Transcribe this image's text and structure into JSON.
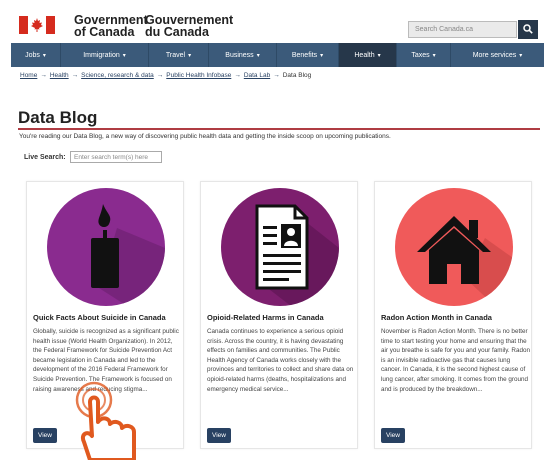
{
  "header": {
    "gov_en_line1": "Government",
    "gov_en_line2": "of Canada",
    "gov_fr_line1": "Gouvernement",
    "gov_fr_line2": "du Canada",
    "search_placeholder": "Search Canada.ca"
  },
  "nav": {
    "items": [
      {
        "label": "Jobs",
        "active": false
      },
      {
        "label": "Immigration",
        "active": false
      },
      {
        "label": "Travel",
        "active": false
      },
      {
        "label": "Business",
        "active": false
      },
      {
        "label": "Benefits",
        "active": false
      },
      {
        "label": "Health",
        "active": true
      },
      {
        "label": "Taxes",
        "active": false
      },
      {
        "label": "More services",
        "active": false
      }
    ]
  },
  "breadcrumb": {
    "items": [
      "Home",
      "Health",
      "Science, research & data",
      "Public Health Infobase",
      "Data Lab"
    ],
    "current": "Data Blog"
  },
  "page": {
    "title": "Data Blog",
    "intro": "You're reading our Data Blog, a new way of discovering public health data and getting the inside scoop on upcoming publications.",
    "live_search_label": "Live Search:",
    "live_search_placeholder": "Enter search term(s) here"
  },
  "cards": [
    {
      "title": "Quick Facts About Suicide in Canada",
      "icon": "candle-icon",
      "color": "#8a2b8f",
      "body": "Globally, suicide is recognized as a significant public health issue (World Health Organization). In 2012, the Federal Framework for Suicide Prevention Act became legislation in Canada and led to the development of the 2016 Federal Framework for Suicide Prevention. The Framework is focused on raising awareness and reducing stigma...",
      "button": "View"
    },
    {
      "title": "Opioid-Related Harms in Canada",
      "icon": "document-icon",
      "color": "#7d1f6e",
      "body": "Canada continues to experience a serious opioid crisis. Across the country, it is having devastating effects on families and communities. The Public Health Agency of Canada works closely with the provinces and territories to collect and share data on opioid-related harms (deaths, hospitalizations and emergency medical service...",
      "button": "View"
    },
    {
      "title": "Radon Action Month in Canada",
      "icon": "house-icon",
      "color": "#f05a5a",
      "body": "November is Radon Action Month. There is no better time to start testing your home and ensuring that the air you breathe is safe for you and your family. Radon is an invisible radioactive gas that causes lung cancer. In Canada, it is the second highest cause of lung cancer, after smoking. It comes from the ground and is produced by the breakdown...",
      "button": "View"
    }
  ]
}
